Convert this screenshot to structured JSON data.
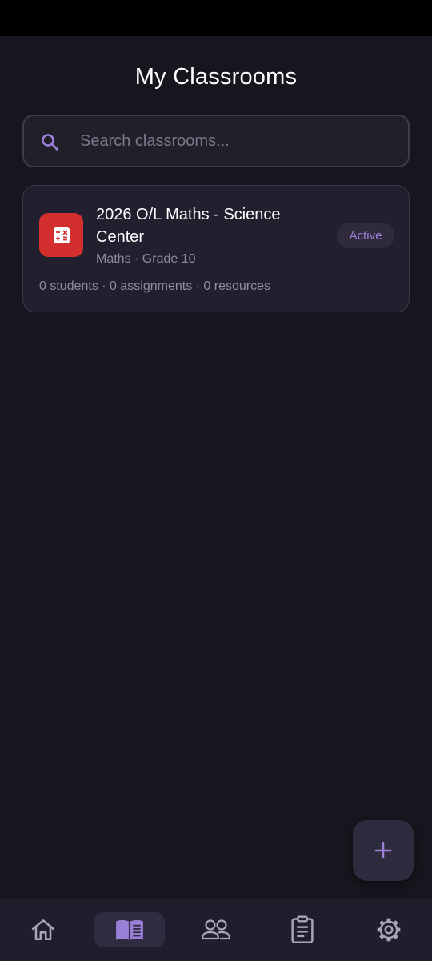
{
  "header": {
    "title": "My Classrooms"
  },
  "search": {
    "placeholder": "Search classrooms..."
  },
  "classrooms": [
    {
      "title": "2026 O/L Maths - Science Center",
      "subject_grade": "Maths · Grade 10",
      "status": "Active",
      "stats": "0 students · 0 assignments · 0 resources",
      "icon": "calculator-icon",
      "icon_color": "#d32f2f"
    }
  ],
  "fab": {
    "icon": "plus-icon"
  },
  "bottom_nav": {
    "items": [
      {
        "icon": "home-icon",
        "active": false
      },
      {
        "icon": "book-icon",
        "active": true
      },
      {
        "icon": "people-icon",
        "active": false
      },
      {
        "icon": "clipboard-icon",
        "active": false
      },
      {
        "icon": "gear-icon",
        "active": false
      }
    ]
  },
  "colors": {
    "background": "#17161e",
    "accent": "#9a7fd6",
    "card": "#221f2e",
    "nav_active": "#2f2c42"
  }
}
